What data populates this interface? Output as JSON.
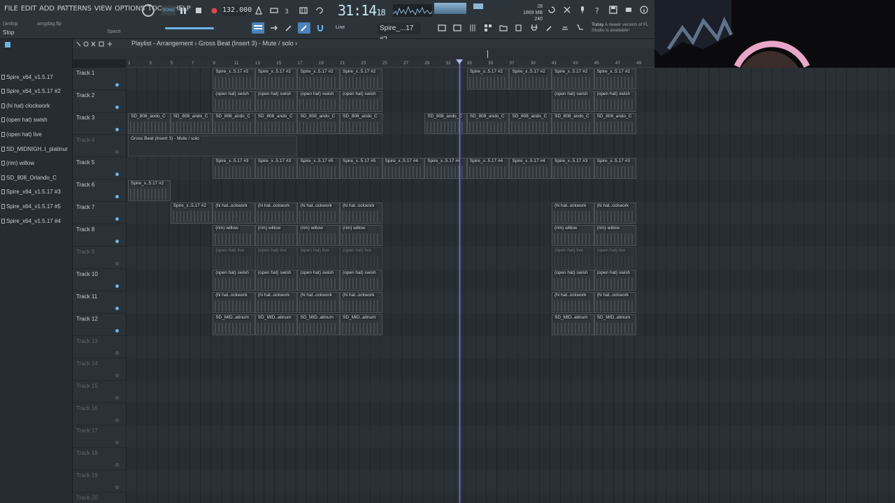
{
  "menu": [
    "FILE",
    "EDIT",
    "ADD",
    "PATTERNS",
    "VIEW",
    "OPTIONS",
    "TOOLS",
    "HELP"
  ],
  "hints": {
    "left": "(amlop",
    "file": "amgdag.flp",
    "stop": "Stop",
    "space": "Space"
  },
  "transport": {
    "mode": "SONG",
    "tempo": "132.000",
    "time_main": "31:14",
    "time_sub": "18"
  },
  "cpu": {
    "mb": "1869 MB",
    "poly": "240",
    "cores": "28"
  },
  "news": {
    "today": "Today",
    "msg": "A newer version of FL Studio is available!"
  },
  "snap": "Line",
  "pattern_selector": "Spire_...17 #2",
  "playlist": {
    "breadcrumb": "Playlist - Arrangement  ›  Gross Beat (Insert 3) - Mute / solo  ›"
  },
  "browser_items": [
    "Spire_x64_v1.5.17",
    "Spire_x64_v1.5.17 #2",
    "(hi hat) clockwork",
    "(open hat) swish",
    "(open hat) live",
    "SD_MIDNIGH..t_platinum",
    "(rim) willow",
    "SD_808_Orlando_C",
    "Spire_x64_v1.5.17 #3",
    "Spire_x64_v1.5.17 #5",
    "Spire_x64_v1.5.17 #4"
  ],
  "ruler": [
    "1",
    "3",
    "5",
    "7",
    "9",
    "11",
    "13",
    "15",
    "17",
    "19",
    "21",
    "23",
    "25",
    "27",
    "29",
    "31",
    "33",
    "35",
    "37",
    "39",
    "41",
    "43",
    "45",
    "47",
    "49"
  ],
  "tracks": [
    {
      "name": "Track 1",
      "active": true
    },
    {
      "name": "Track 2",
      "active": true
    },
    {
      "name": "Track 3",
      "active": true
    },
    {
      "name": "Track 4",
      "active": false
    },
    {
      "name": "Track 5",
      "active": true
    },
    {
      "name": "Track 6",
      "active": true
    },
    {
      "name": "Track 7",
      "active": true
    },
    {
      "name": "Track 8",
      "active": true
    },
    {
      "name": "Track 9",
      "active": false
    },
    {
      "name": "Track 10",
      "active": true
    },
    {
      "name": "Track 11",
      "active": true
    },
    {
      "name": "Track 12",
      "active": true
    },
    {
      "name": "Track 13",
      "active": false
    },
    {
      "name": "Track 14",
      "active": false
    },
    {
      "name": "Track 15",
      "active": false
    },
    {
      "name": "Track 16",
      "active": false
    },
    {
      "name": "Track 17",
      "active": false
    },
    {
      "name": "Track 18",
      "active": false
    },
    {
      "name": "Track 19",
      "active": false
    },
    {
      "name": "Track 20",
      "active": false
    }
  ],
  "clips": [
    {
      "track": 0,
      "bars": [
        9,
        13
      ],
      "label": "Spire_x..5.17 #2"
    },
    {
      "track": 0,
      "bars": [
        13,
        17
      ],
      "label": "Spire_x..5.17 #2"
    },
    {
      "track": 0,
      "bars": [
        17,
        21
      ],
      "label": "Spire_x..5.17 #2"
    },
    {
      "track": 0,
      "bars": [
        21,
        25
      ],
      "label": "Spire_x..5.17 #2"
    },
    {
      "track": 0,
      "bars": [
        33,
        37
      ],
      "label": "Spire_x..5.17 #2"
    },
    {
      "track": 0,
      "bars": [
        37,
        41
      ],
      "label": "Spire_x..5.17 #2"
    },
    {
      "track": 0,
      "bars": [
        41,
        45
      ],
      "label": "Spire_x..5.17 #2"
    },
    {
      "track": 0,
      "bars": [
        45,
        49
      ],
      "label": "Spire_x..5.17 #2"
    },
    {
      "track": 1,
      "bars": [
        9,
        13
      ],
      "label": "(open hat) swish"
    },
    {
      "track": 1,
      "bars": [
        13,
        17
      ],
      "label": "(open hat) swish"
    },
    {
      "track": 1,
      "bars": [
        17,
        21
      ],
      "label": "(open hat) swish"
    },
    {
      "track": 1,
      "bars": [
        21,
        25
      ],
      "label": "(open hat) swish"
    },
    {
      "track": 1,
      "bars": [
        41,
        45
      ],
      "label": "(open hat) swish"
    },
    {
      "track": 1,
      "bars": [
        45,
        49
      ],
      "label": "(open hat) swish"
    },
    {
      "track": 2,
      "bars": [
        1,
        5
      ],
      "label": "SD_808_ando_C"
    },
    {
      "track": 2,
      "bars": [
        5,
        9
      ],
      "label": "SD_808_ando_C"
    },
    {
      "track": 2,
      "bars": [
        9,
        13
      ],
      "label": "SD_808_ando_C"
    },
    {
      "track": 2,
      "bars": [
        13,
        17
      ],
      "label": "SD_808_ando_C"
    },
    {
      "track": 2,
      "bars": [
        17,
        21
      ],
      "label": "SD_808_ando_C"
    },
    {
      "track": 2,
      "bars": [
        21,
        25
      ],
      "label": "SD_808_ando_C"
    },
    {
      "track": 2,
      "bars": [
        29,
        33
      ],
      "label": "SD_808_ando_C"
    },
    {
      "track": 2,
      "bars": [
        33,
        37
      ],
      "label": "SD_808_ando_C"
    },
    {
      "track": 2,
      "bars": [
        37,
        41
      ],
      "label": "SD_808_ando_C"
    },
    {
      "track": 2,
      "bars": [
        41,
        45
      ],
      "label": "SD_808_ando_C"
    },
    {
      "track": 2,
      "bars": [
        45,
        49
      ],
      "label": "SD_808_ando_C"
    },
    {
      "track": 3,
      "bars": [
        1,
        17
      ],
      "label": "Gross Beat (Insert 3) - Mute / solo",
      "automation": true
    },
    {
      "track": 4,
      "bars": [
        9,
        13
      ],
      "label": "Spire_x..5.17 #3"
    },
    {
      "track": 4,
      "bars": [
        13,
        17
      ],
      "label": "Spire_x..5.17 #3"
    },
    {
      "track": 4,
      "bars": [
        17,
        21
      ],
      "label": "Spire_x..5.17 #5"
    },
    {
      "track": 4,
      "bars": [
        21,
        25
      ],
      "label": "Spire_x..5.17 #5"
    },
    {
      "track": 4,
      "bars": [
        25,
        29
      ],
      "label": "Spire_x..5.17 #4"
    },
    {
      "track": 4,
      "bars": [
        29,
        33
      ],
      "label": "Spire_x..5.17 #4"
    },
    {
      "track": 4,
      "bars": [
        33,
        37
      ],
      "label": "Spire_x..5.17 #4"
    },
    {
      "track": 4,
      "bars": [
        37,
        41
      ],
      "label": "Spire_x..5.17 #4"
    },
    {
      "track": 4,
      "bars": [
        41,
        45
      ],
      "label": "Spire_x..5.17 #3"
    },
    {
      "track": 4,
      "bars": [
        45,
        49
      ],
      "label": "Spire_x..5.17 #3"
    },
    {
      "track": 5,
      "bars": [
        1,
        5
      ],
      "label": "Spire_x..5.17 #2"
    },
    {
      "track": 6,
      "bars": [
        5,
        9
      ],
      "label": "Spire_x..5.17 #2"
    },
    {
      "track": 6,
      "bars": [
        9,
        13
      ],
      "label": "(hi hat..ockwork"
    },
    {
      "track": 6,
      "bars": [
        13,
        17
      ],
      "label": "(hi hat..ockwork"
    },
    {
      "track": 6,
      "bars": [
        17,
        21
      ],
      "label": "(hi hat..ockwork"
    },
    {
      "track": 6,
      "bars": [
        21,
        25
      ],
      "label": "(hi hat..ockwork"
    },
    {
      "track": 6,
      "bars": [
        41,
        45
      ],
      "label": "(hi hat..ockwork"
    },
    {
      "track": 6,
      "bars": [
        45,
        49
      ],
      "label": "(hi hat..ockwork"
    },
    {
      "track": 7,
      "bars": [
        9,
        13
      ],
      "label": "(rim) willow"
    },
    {
      "track": 7,
      "bars": [
        13,
        17
      ],
      "label": "(rim) willow"
    },
    {
      "track": 7,
      "bars": [
        17,
        21
      ],
      "label": "(rim) willow"
    },
    {
      "track": 7,
      "bars": [
        21,
        25
      ],
      "label": "(rim) willow"
    },
    {
      "track": 7,
      "bars": [
        41,
        45
      ],
      "label": "(rim) willow"
    },
    {
      "track": 7,
      "bars": [
        45,
        49
      ],
      "label": "(rim) willow"
    },
    {
      "track": 8,
      "bars": [
        9,
        13
      ],
      "label": "(open hat) live",
      "muted": true
    },
    {
      "track": 8,
      "bars": [
        13,
        17
      ],
      "label": "(open hat) live",
      "muted": true
    },
    {
      "track": 8,
      "bars": [
        17,
        21
      ],
      "label": "(open hat) live",
      "muted": true
    },
    {
      "track": 8,
      "bars": [
        21,
        25
      ],
      "label": "(open hat) live",
      "muted": true
    },
    {
      "track": 8,
      "bars": [
        41,
        45
      ],
      "label": "(open hat) live",
      "muted": true
    },
    {
      "track": 8,
      "bars": [
        45,
        49
      ],
      "label": "(open hat) live",
      "muted": true
    },
    {
      "track": 9,
      "bars": [
        9,
        13
      ],
      "label": "(open hat) swish"
    },
    {
      "track": 9,
      "bars": [
        13,
        17
      ],
      "label": "(open hat) swish"
    },
    {
      "track": 9,
      "bars": [
        17,
        21
      ],
      "label": "(open hat) swish"
    },
    {
      "track": 9,
      "bars": [
        21,
        25
      ],
      "label": "(open hat) swish"
    },
    {
      "track": 9,
      "bars": [
        41,
        45
      ],
      "label": "(open hat) swish"
    },
    {
      "track": 9,
      "bars": [
        45,
        49
      ],
      "label": "(open hat) swish"
    },
    {
      "track": 10,
      "bars": [
        9,
        13
      ],
      "label": "(hi hat..ockwork"
    },
    {
      "track": 10,
      "bars": [
        13,
        17
      ],
      "label": "(hi hat..ockwork"
    },
    {
      "track": 10,
      "bars": [
        17,
        21
      ],
      "label": "(hi hat..ockwork"
    },
    {
      "track": 10,
      "bars": [
        21,
        25
      ],
      "label": "(hi hat..ockwork"
    },
    {
      "track": 10,
      "bars": [
        41,
        45
      ],
      "label": "(hi hat..ockwork"
    },
    {
      "track": 10,
      "bars": [
        45,
        49
      ],
      "label": "(hi hat..ockwork"
    },
    {
      "track": 11,
      "bars": [
        9,
        13
      ],
      "label": "SD_MID..atinum"
    },
    {
      "track": 11,
      "bars": [
        13,
        17
      ],
      "label": "SD_MID..atinum"
    },
    {
      "track": 11,
      "bars": [
        17,
        21
      ],
      "label": "SD_MID..atinum"
    },
    {
      "track": 11,
      "bars": [
        21,
        25
      ],
      "label": "SD_MID..atinum"
    },
    {
      "track": 11,
      "bars": [
        41,
        45
      ],
      "label": "SD_MID..atinum"
    },
    {
      "track": 11,
      "bars": [
        45,
        49
      ],
      "label": "SD_MID..atinum"
    }
  ],
  "playhead_bar": 32.3,
  "colors": {
    "playhead": "#6e7cf0",
    "accent": "#6fb3e6",
    "record": "#e04848"
  }
}
